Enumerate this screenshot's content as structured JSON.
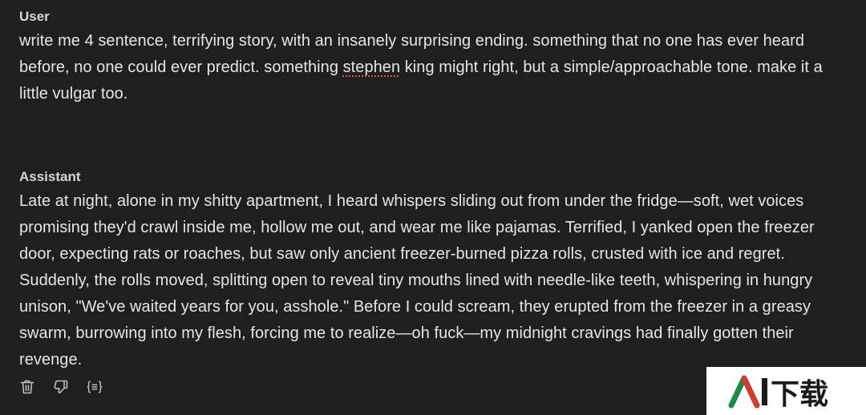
{
  "conversation": {
    "user": {
      "role": "User",
      "text_before": "write me 4 sentence, terrifying story, with an insanely surprising ending. something that no one has ever heard before, no one could ever predict. something ",
      "misspelled": "stephen",
      "text_after": " king might right, but a simple/approachable tone. make it a little vulgar too."
    },
    "assistant": {
      "role": "Assistant",
      "text": "Late at night, alone in my shitty apartment, I heard whispers sliding out from under the fridge—soft, wet voices promising they'd crawl inside me, hollow me out, and wear me like pajamas. Terrified, I yanked open the freezer door, expecting rats or roaches, but saw only ancient freezer-burned pizza rolls, crusted with ice and regret. Suddenly, the rolls moved, splitting open to reveal tiny mouths lined with needle-like teeth, whispering in hungry unison, \"We've waited years for you, asshole.\" Before I could scream, they erupted from the freezer in a greasy swarm, burrowing into my flesh, forcing me to realize—oh fuck—my midnight cravings had finally gotten their revenge."
    }
  },
  "actions": {
    "icons": [
      "trash-icon",
      "thumbs-down-icon",
      "code-braces-icon"
    ]
  },
  "watermark": {
    "text": "AI下载",
    "colors": {
      "accent": "#1e8a4a",
      "text": "#1a1a1a"
    }
  }
}
